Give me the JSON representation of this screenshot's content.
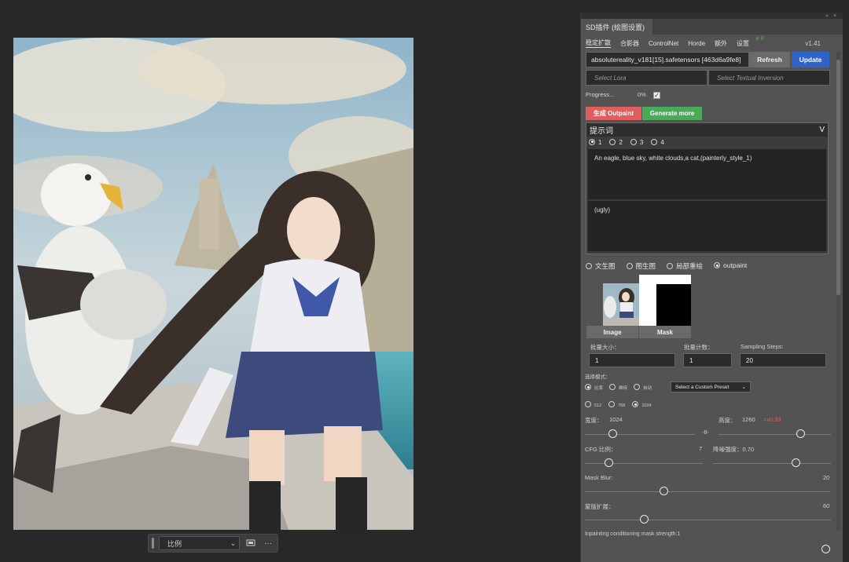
{
  "canvas": {
    "context_bar": {
      "ratio_label": "比例",
      "more_label": "···"
    }
  },
  "panel": {
    "title": "SD插件 (绘图设置)",
    "menu": [
      "稳定扩散",
      "合影器",
      "ControlNet",
      "Horde",
      "额外",
      "设置"
    ],
    "menu_badge": "✕ P",
    "version": "v1.41",
    "model": {
      "value": "absolutereality_v181[15].safetensors [463d6a9fe8]",
      "refresh_label": "Refresh",
      "update_label": "Update"
    },
    "lora_placeholder": "Select Lora",
    "ti_placeholder": "Select Textual Inversion",
    "progress_label": "Progress...",
    "progress_value": "0%",
    "generate_label": "生成 Outpaint",
    "generate_more_label": "Generate more",
    "prompt": {
      "header": "提示词",
      "chevron": "V",
      "tabs": [
        "1",
        "2",
        "3",
        "4"
      ],
      "positive": "An eagle, blue sky, white clouds,a cat,(painterly_style_1)",
      "negative": "(ugly)"
    },
    "modes": [
      "文生图",
      "图生图",
      "局部重绘",
      "outpaint"
    ],
    "image_label": "Image",
    "mask_label": "Mask",
    "batch_size": {
      "label": "批量大小：",
      "value": "1"
    },
    "batch_count": {
      "label": "批量计数：",
      "value": "1"
    },
    "steps": {
      "label": "Sampling Steps:",
      "value": "20"
    },
    "select_mode_label": "选择模式：",
    "select_modes": [
      "比率",
      "维持",
      "自动"
    ],
    "preset": "Select a Custom Preset",
    "sizes": [
      "512",
      "768",
      "1024"
    ],
    "width": {
      "label": "宽度：",
      "value": "1024",
      "fraction": 0.25
    },
    "height": {
      "label": "高度：",
      "value": "1260",
      "ratio": "≈x0.33",
      "fraction": 0.73
    },
    "link_icon_glyph": "-8-",
    "cfg": {
      "label": "CFG 比例：",
      "value": "7",
      "fraction": 0.2
    },
    "denoise": {
      "label": "降噪强度：0.70",
      "fraction": 0.7
    },
    "mask_blur": {
      "label": "Mask Blur:",
      "value": "20",
      "fraction": 0.32
    },
    "mask_expand": {
      "label": "蒙版扩展：",
      "value": "60",
      "fraction": 0.24
    },
    "inpaint_strength_label": "Inpainting conditioning mask strength:1",
    "colors": {
      "update": "#2e63c8",
      "generate": "#e05e5e",
      "generate_more": "#4aaa5a",
      "ratio": "#e06060"
    }
  }
}
